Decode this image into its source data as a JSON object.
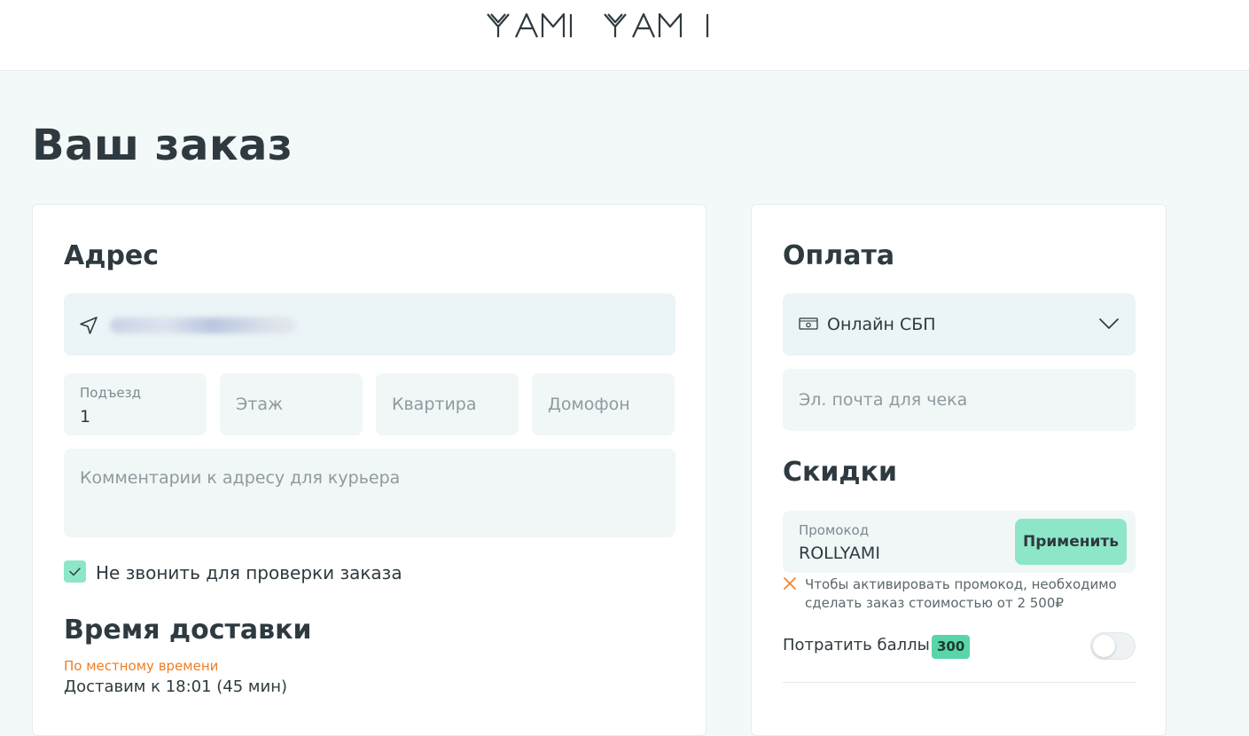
{
  "header": {
    "logo_text": "YAMI YAMI",
    "logo_icon": "yami-yami-logo"
  },
  "page": {
    "title": "Ваш заказ"
  },
  "address": {
    "title": "Адрес",
    "location_icon": "navigation-arrow-icon",
    "entrance": {
      "label": "Подъезд",
      "value": "1"
    },
    "floor": {
      "placeholder": "Этаж"
    },
    "apartment": {
      "placeholder": "Квартира"
    },
    "intercom": {
      "placeholder": "Домофон"
    },
    "comment": {
      "placeholder": "Комментарии к адресу для курьера"
    },
    "no_call": {
      "label": "Не звонить для проверки заказа",
      "checked": true
    }
  },
  "delivery": {
    "title": "Время доставки",
    "time_note": "По местному времени",
    "eta": "Доставим к 18:01 (45 мин)"
  },
  "payment": {
    "title": "Оплата",
    "method": "Онлайн СБП",
    "method_icon": "cash-icon",
    "email_placeholder": "Эл. почта для чека"
  },
  "discounts": {
    "title": "Скидки",
    "promo_label": "Промокод",
    "promo_value": "ROLLYAMI",
    "apply_label": "Применить",
    "promo_error": "Чтобы активировать промокод, необходимо сделать заказ стоимостью от 2 500₽",
    "points_label": "Потратить баллы",
    "points_value": "300",
    "points_enabled": false
  },
  "colors": {
    "accent": "#8ee6c8",
    "badge": "#59d5a8",
    "warning": "#f07d22",
    "text": "#2e3a3f",
    "field_bg": "#f1f6f7"
  }
}
